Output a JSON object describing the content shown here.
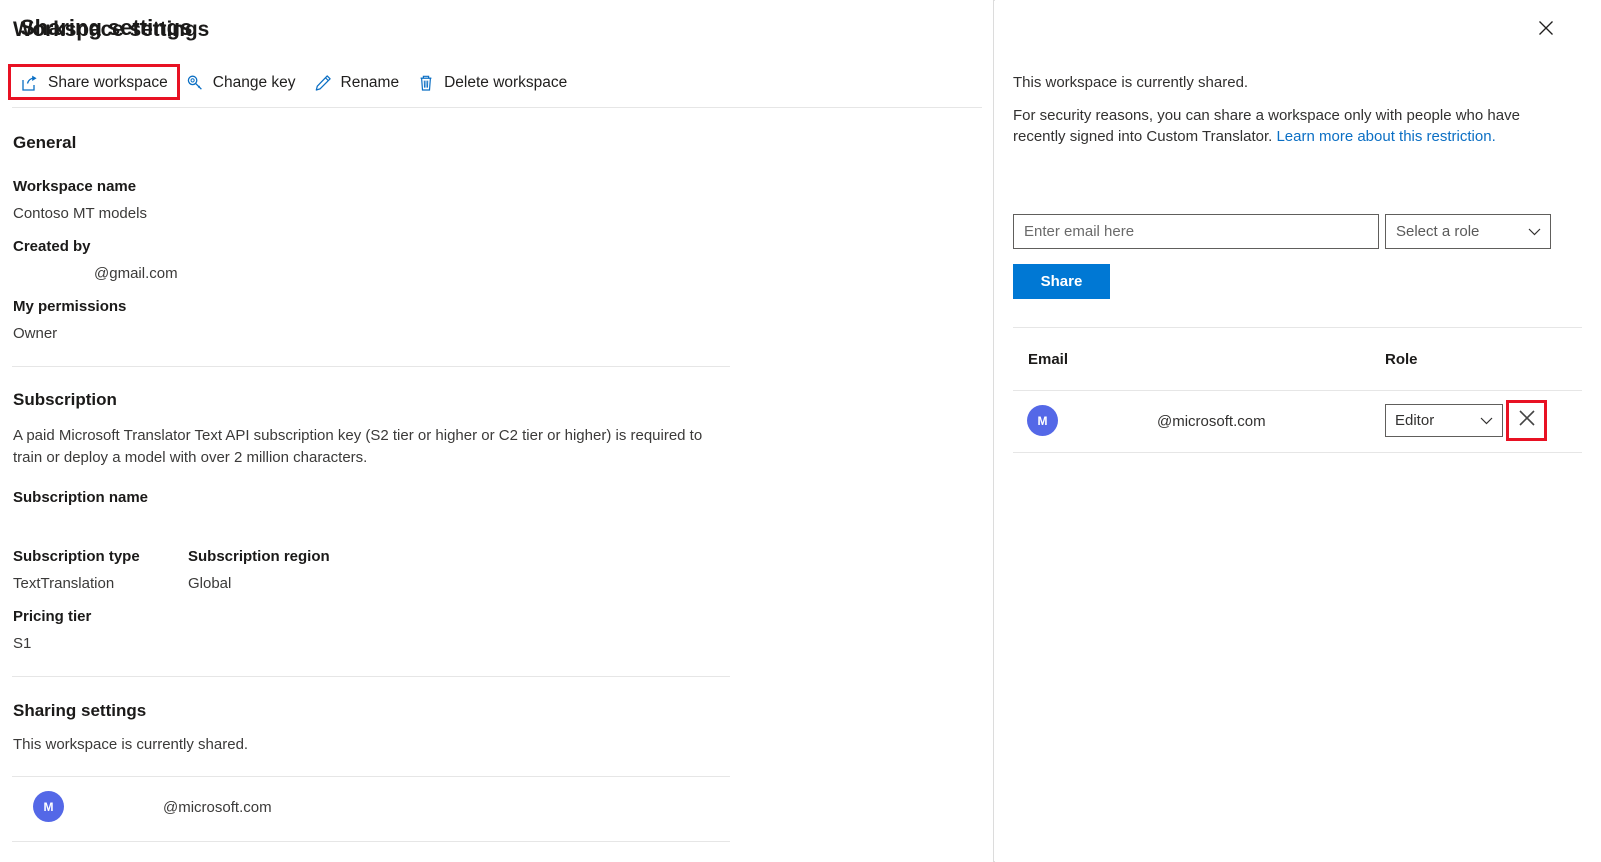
{
  "left": {
    "title": "Workspace settings",
    "toolbar": [
      {
        "icon": "share-icon",
        "label": "Share workspace"
      },
      {
        "icon": "key-icon",
        "label": "Change key"
      },
      {
        "icon": "pencil-icon",
        "label": "Rename"
      },
      {
        "icon": "trash-icon",
        "label": "Delete workspace"
      }
    ],
    "general": {
      "heading": "General",
      "workspace_name_label": "Workspace name",
      "workspace_name_value": "Contoso MT models",
      "created_by_label": "Created by",
      "created_by_value": "@gmail.com",
      "permissions_label": "My permissions",
      "permissions_value": "Owner"
    },
    "subscription": {
      "heading": "Subscription",
      "description": "A paid Microsoft Translator Text API subscription key (S2 tier or higher or C2 tier or higher) is required to train or deploy a model with over 2 million characters.",
      "name_label": "Subscription name",
      "name_value": "",
      "type_label": "Subscription type",
      "type_value": "TextTranslation",
      "region_label": "Subscription region",
      "region_value": "Global",
      "pricing_label": "Pricing tier",
      "pricing_value": "S1"
    },
    "sharing": {
      "heading": "Sharing settings",
      "status": "This workspace is currently shared.",
      "member": {
        "avatar_initial": "M",
        "email": "@microsoft.com"
      }
    }
  },
  "right": {
    "title": "Sharing settings",
    "close_icon": "close-icon",
    "status": "This workspace is currently shared.",
    "security_note_part1": "For security reasons, you can share a workspace only with people who have recently signed into Custom Translator. ",
    "security_note_link": "Learn more about this restriction.",
    "email_placeholder": "Enter email here",
    "role_placeholder": "Select a role",
    "share_button": "Share",
    "table": {
      "columns": [
        "Email",
        "Role"
      ],
      "rows": [
        {
          "avatar_initial": "M",
          "email": "@microsoft.com",
          "role": "Editor",
          "remove_icon": "close-icon"
        }
      ]
    }
  },
  "colors": {
    "accent": "#0078d4",
    "link": "#0b6fc4",
    "highlight": "#e81123",
    "avatar": "#5468e7"
  }
}
